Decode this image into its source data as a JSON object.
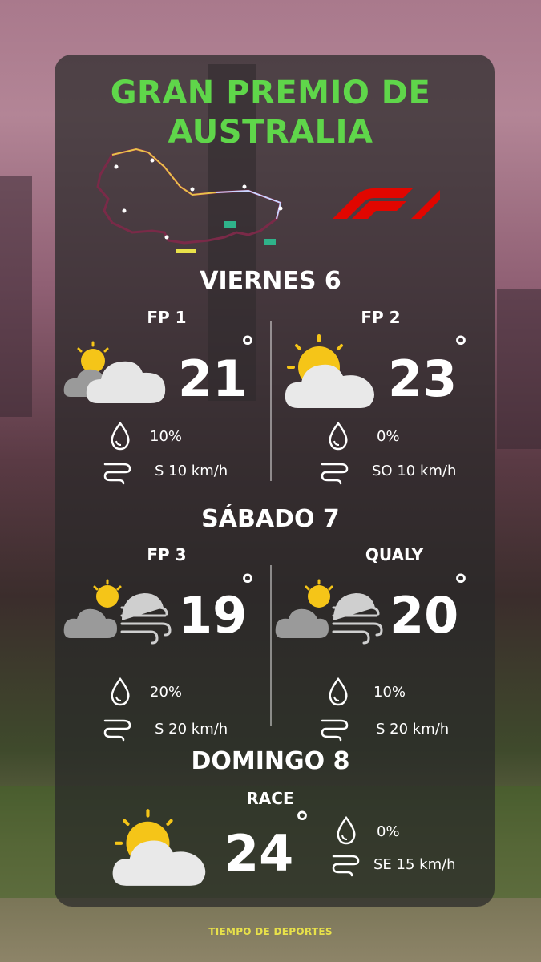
{
  "title_line1": "GRAN PREMIO DE",
  "title_line2": "AUSTRALIA",
  "friday": {
    "label": "VIERNES 6",
    "fp1": {
      "name": "FP 1",
      "temp": "21",
      "deg": "°",
      "rain": "10%",
      "wind": "S 10 km/h",
      "icon": "partly-cloudy-icon"
    },
    "fp2": {
      "name": "FP 2",
      "temp": "23",
      "deg": "°",
      "rain": "0%",
      "wind": "SO 10 km/h",
      "icon": "sun-behind-cloud-icon"
    }
  },
  "saturday": {
    "label": "SÁBADO 7",
    "fp3": {
      "name": "FP 3",
      "temp": "19",
      "deg": "°",
      "rain": "20%",
      "wind": "S 20 km/h",
      "icon": "cloudy-windy-icon"
    },
    "qualy": {
      "name": "QUALY",
      "temp": "20",
      "deg": "°",
      "rain": "10%",
      "wind": "S 20 km/h",
      "icon": "cloudy-windy-icon"
    }
  },
  "sunday": {
    "label": "DOMINGO 8",
    "race": {
      "name": "RACE",
      "temp": "24",
      "deg": "°",
      "rain": "0%",
      "wind": "SE 15 km/h",
      "icon": "sun-behind-cloud-icon"
    }
  },
  "footer": "TIEMPO DE DEPORTES",
  "colors": {
    "title": "#5fd64a",
    "f1_red": "#e10600",
    "sun": "#f5c518",
    "cloud": "#e9e9e9",
    "footer": "#e8e14a"
  }
}
